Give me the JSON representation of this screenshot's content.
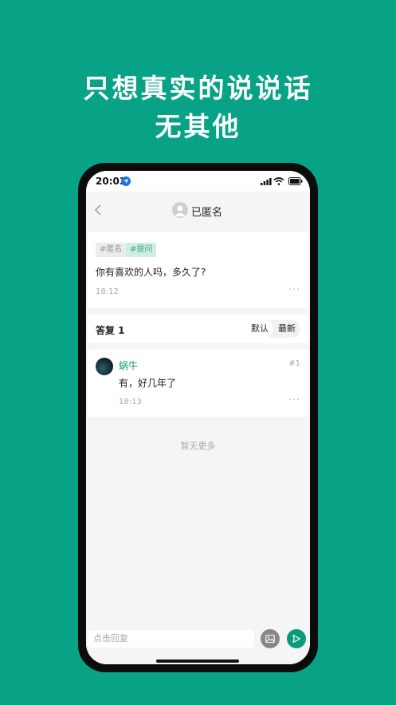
{
  "promo": {
    "line1": "只想真实的说说话",
    "line2": "无其他"
  },
  "colors": {
    "background": "#08a386",
    "accent": "#0a9b7d",
    "name": "#14a082"
  },
  "statusbar": {
    "time": "20:03"
  },
  "navbar": {
    "title": "已匿名"
  },
  "post": {
    "tags": [
      "#匿名",
      "#提问"
    ],
    "text": "你有喜欢的人吗，多久了?",
    "time": "18:12"
  },
  "replies_header": {
    "label": "答复 1",
    "sort_options": [
      "默认",
      "最新"
    ]
  },
  "replies": [
    {
      "name": "蜗牛",
      "floor": "#1",
      "text": "有，好几年了",
      "time": "18:13"
    }
  ],
  "footer_note": "暂无更多",
  "composer": {
    "placeholder": "点击回复"
  }
}
